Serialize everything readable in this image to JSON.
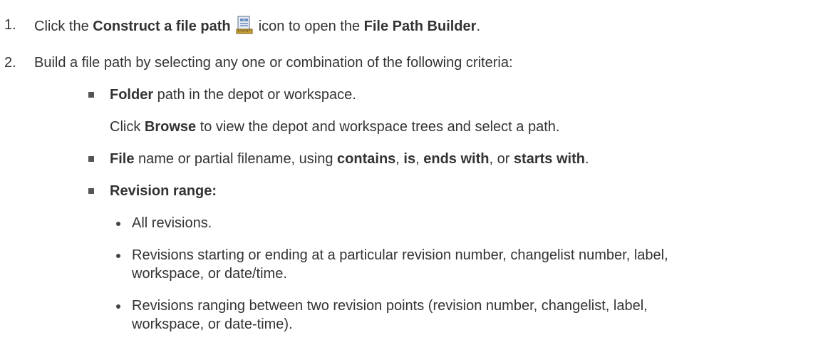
{
  "steps": [
    {
      "number": "1.",
      "parts": [
        "Click the ",
        "Construct a file path",
        " icon to open the ",
        "File Path Builder",
        "."
      ],
      "icon": "file-path-builder-icon"
    },
    {
      "number": "2.",
      "text": "Build a file path by selecting any one or combination of the following criteria:"
    }
  ],
  "criteria": {
    "folder": {
      "bold": "Folder",
      "rest": " path in the depot or workspace."
    },
    "browse": {
      "pre": "Click ",
      "bold": "Browse",
      "rest": " to view the depot and workspace trees and select a path."
    },
    "file": {
      "bold": "File",
      "mid": " name or partial filename, using ",
      "op1": "contains",
      "sep1": ", ",
      "op2": "is",
      "sep2": ", ",
      "op3": "ends with",
      "sep3": ", or ",
      "op4": "starts with",
      "end": "."
    },
    "revision": {
      "bold": "Revision range:"
    },
    "revision_items": [
      {
        "line1": "All revisions."
      },
      {
        "line1": "Revisions starting or ending at a particular revision number, changelist number, label,",
        "line2": "workspace, or date/time."
      },
      {
        "line1": "Revisions ranging between two revision points (revision number, changelist, label,",
        "line2": "workspace, or date-time)."
      }
    ]
  },
  "colors": {
    "text": "#333333",
    "bullet": "#555555"
  }
}
